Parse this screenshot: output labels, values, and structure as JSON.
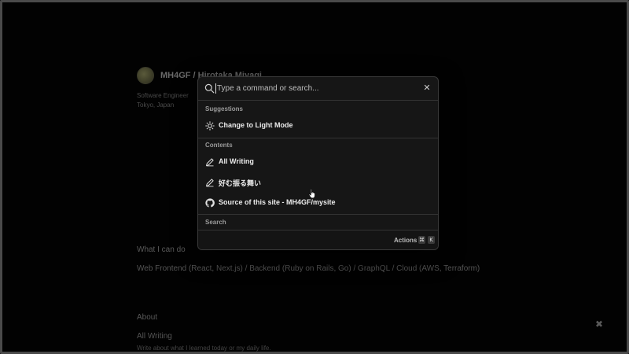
{
  "background": {
    "profile_name": "MH4GF / Hirotaka Miyagi",
    "profile_role_line1": "Software Engineer",
    "profile_role_line2": "Tokyo, Japan",
    "what_i_can_do_heading": "What I can do",
    "what_i_can_do_text": "Web Frontend (React, Next.js) / Backend (Ruby on Rails, Go) / GraphQL / Cloud (AWS, Terraform)",
    "about_heading": "About",
    "all_writing_link": "All Writing",
    "all_writing_desc": "Write about what I learned today or my daily life."
  },
  "palette": {
    "search": {
      "placeholder": "Type a command or search...",
      "value": ""
    },
    "close_icon": "close-icon",
    "groups": {
      "suggestions_label": "Suggestions",
      "contents_label": "Contents",
      "search_label": "Search"
    },
    "items": [
      {
        "label": "Change to Light Mode",
        "icon": "sun-icon"
      },
      {
        "label": "All Writing",
        "icon": "pencil-icon"
      },
      {
        "label": "好む振る舞い",
        "icon": "pencil-icon"
      },
      {
        "label": "Source of this site - MH4GF/mysite",
        "icon": "github-icon"
      }
    ],
    "footer": {
      "actions_label": "Actions",
      "shortcut_keys": [
        "⌘",
        "K"
      ]
    }
  },
  "colors": {
    "background": "#020202",
    "palette_bg": "#161616",
    "border": "#3a3a3a",
    "text_primary": "#ececec",
    "text_muted": "#9a9a9a"
  }
}
